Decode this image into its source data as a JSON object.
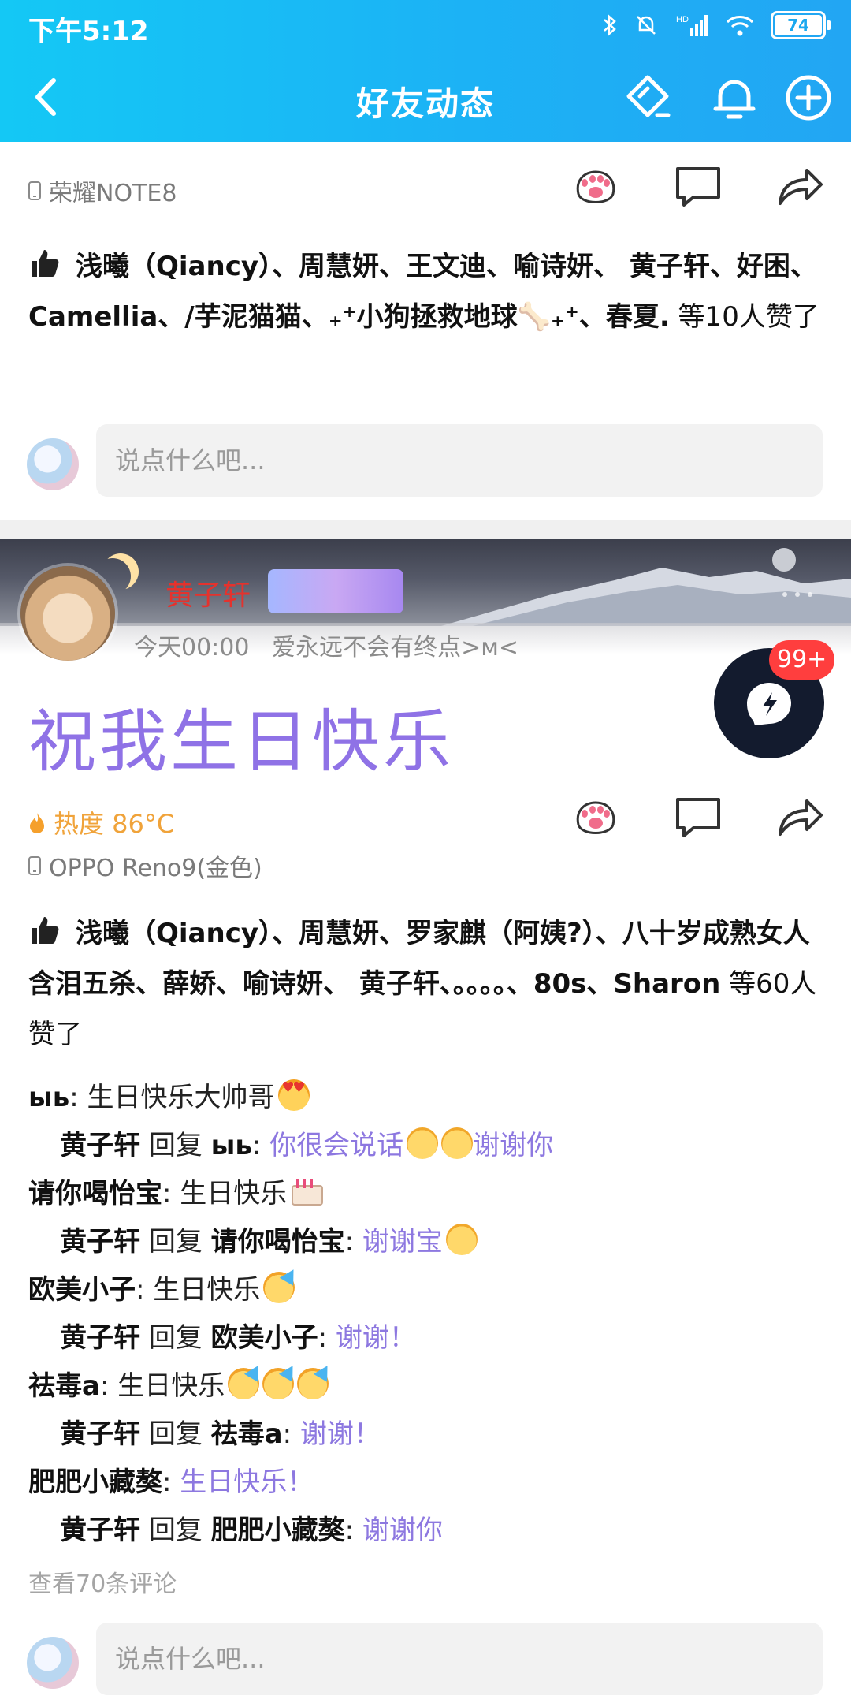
{
  "status_bar": {
    "time": "下午5:12",
    "battery": "74",
    "network": "HD"
  },
  "nav": {
    "title": "好友动态"
  },
  "post1": {
    "device": "荣耀NOTE8",
    "likes": {
      "names": "浅曦（Qiancy）、周慧妍、王文迪、喻诗妍、   黄子轩、好困、Camellia、/芋泥猫猫、₊⁺小狗拯救地球🦴₊⁺、春夏.",
      "suffix": " 等10人赞了"
    },
    "comment_placeholder": "说点什么吧..."
  },
  "post2": {
    "username": "黄子轩",
    "time": "今天00:00",
    "signature": "爱永远不会有终点>ᴍ<",
    "text": "祝我生日快乐",
    "heat": "热度 86°C",
    "device": "OPPO Reno9(金色)",
    "likes": {
      "names": "浅曦（Qiancy）、周慧妍、罗家麒（阿姨?）、八十岁成熟女人含泪五杀、薛娇、喻诗妍、   黄子轩、。。。。、80s、Sharon",
      "suffix": " 等60人赞了"
    },
    "comments": [
      {
        "name": "ыь",
        "text": "生日快乐大帅哥",
        "emoji": "heart-eyes"
      },
      {
        "name": "黄子轩",
        "reply_label": "回复",
        "to": "ыь",
        "text": "你很会说话",
        "emoji": "blush",
        "text2": "谢谢你"
      },
      {
        "name": "请你喝怡宝",
        "text": "生日快乐",
        "emoji": "cake"
      },
      {
        "name": "黄子轩",
        "reply_label": "回复",
        "to": "请你喝怡宝",
        "text": "谢谢宝",
        "emoji": "blush"
      },
      {
        "name": "欧美小子",
        "text": "生日快乐",
        "emoji": "party"
      },
      {
        "name": "黄子轩",
        "reply_label": "回复",
        "to": "欧美小子",
        "text": "谢谢！"
      },
      {
        "name": "祛毒a",
        "text": "生日快乐",
        "emoji": "party x3"
      },
      {
        "name": "黄子轩",
        "reply_label": "回复",
        "to": "祛毒a",
        "text": "谢谢！"
      },
      {
        "name": "肥肥小藏獒",
        "text": "生日快乐！"
      },
      {
        "name": "黄子轩",
        "reply_label": "回复",
        "to": "肥肥小藏獒",
        "text": "谢谢你"
      }
    ],
    "view_more": "查看70条评论",
    "comment_placeholder": "说点什么吧..."
  },
  "fab": {
    "badge": "99+"
  },
  "colors": {
    "header": "#1cb2f5",
    "accent_purple": "#8d78e0",
    "username_red": "#e5322d",
    "heat_orange": "#f0a33a",
    "badge_red": "#ff3e3e"
  },
  "icons": [
    "back-icon",
    "diamond-edit-icon",
    "bell-icon",
    "add-circle-icon",
    "paw-icon",
    "comment-icon",
    "share-icon",
    "thumb-up-icon",
    "flame-icon",
    "lightning-chat-icon"
  ]
}
